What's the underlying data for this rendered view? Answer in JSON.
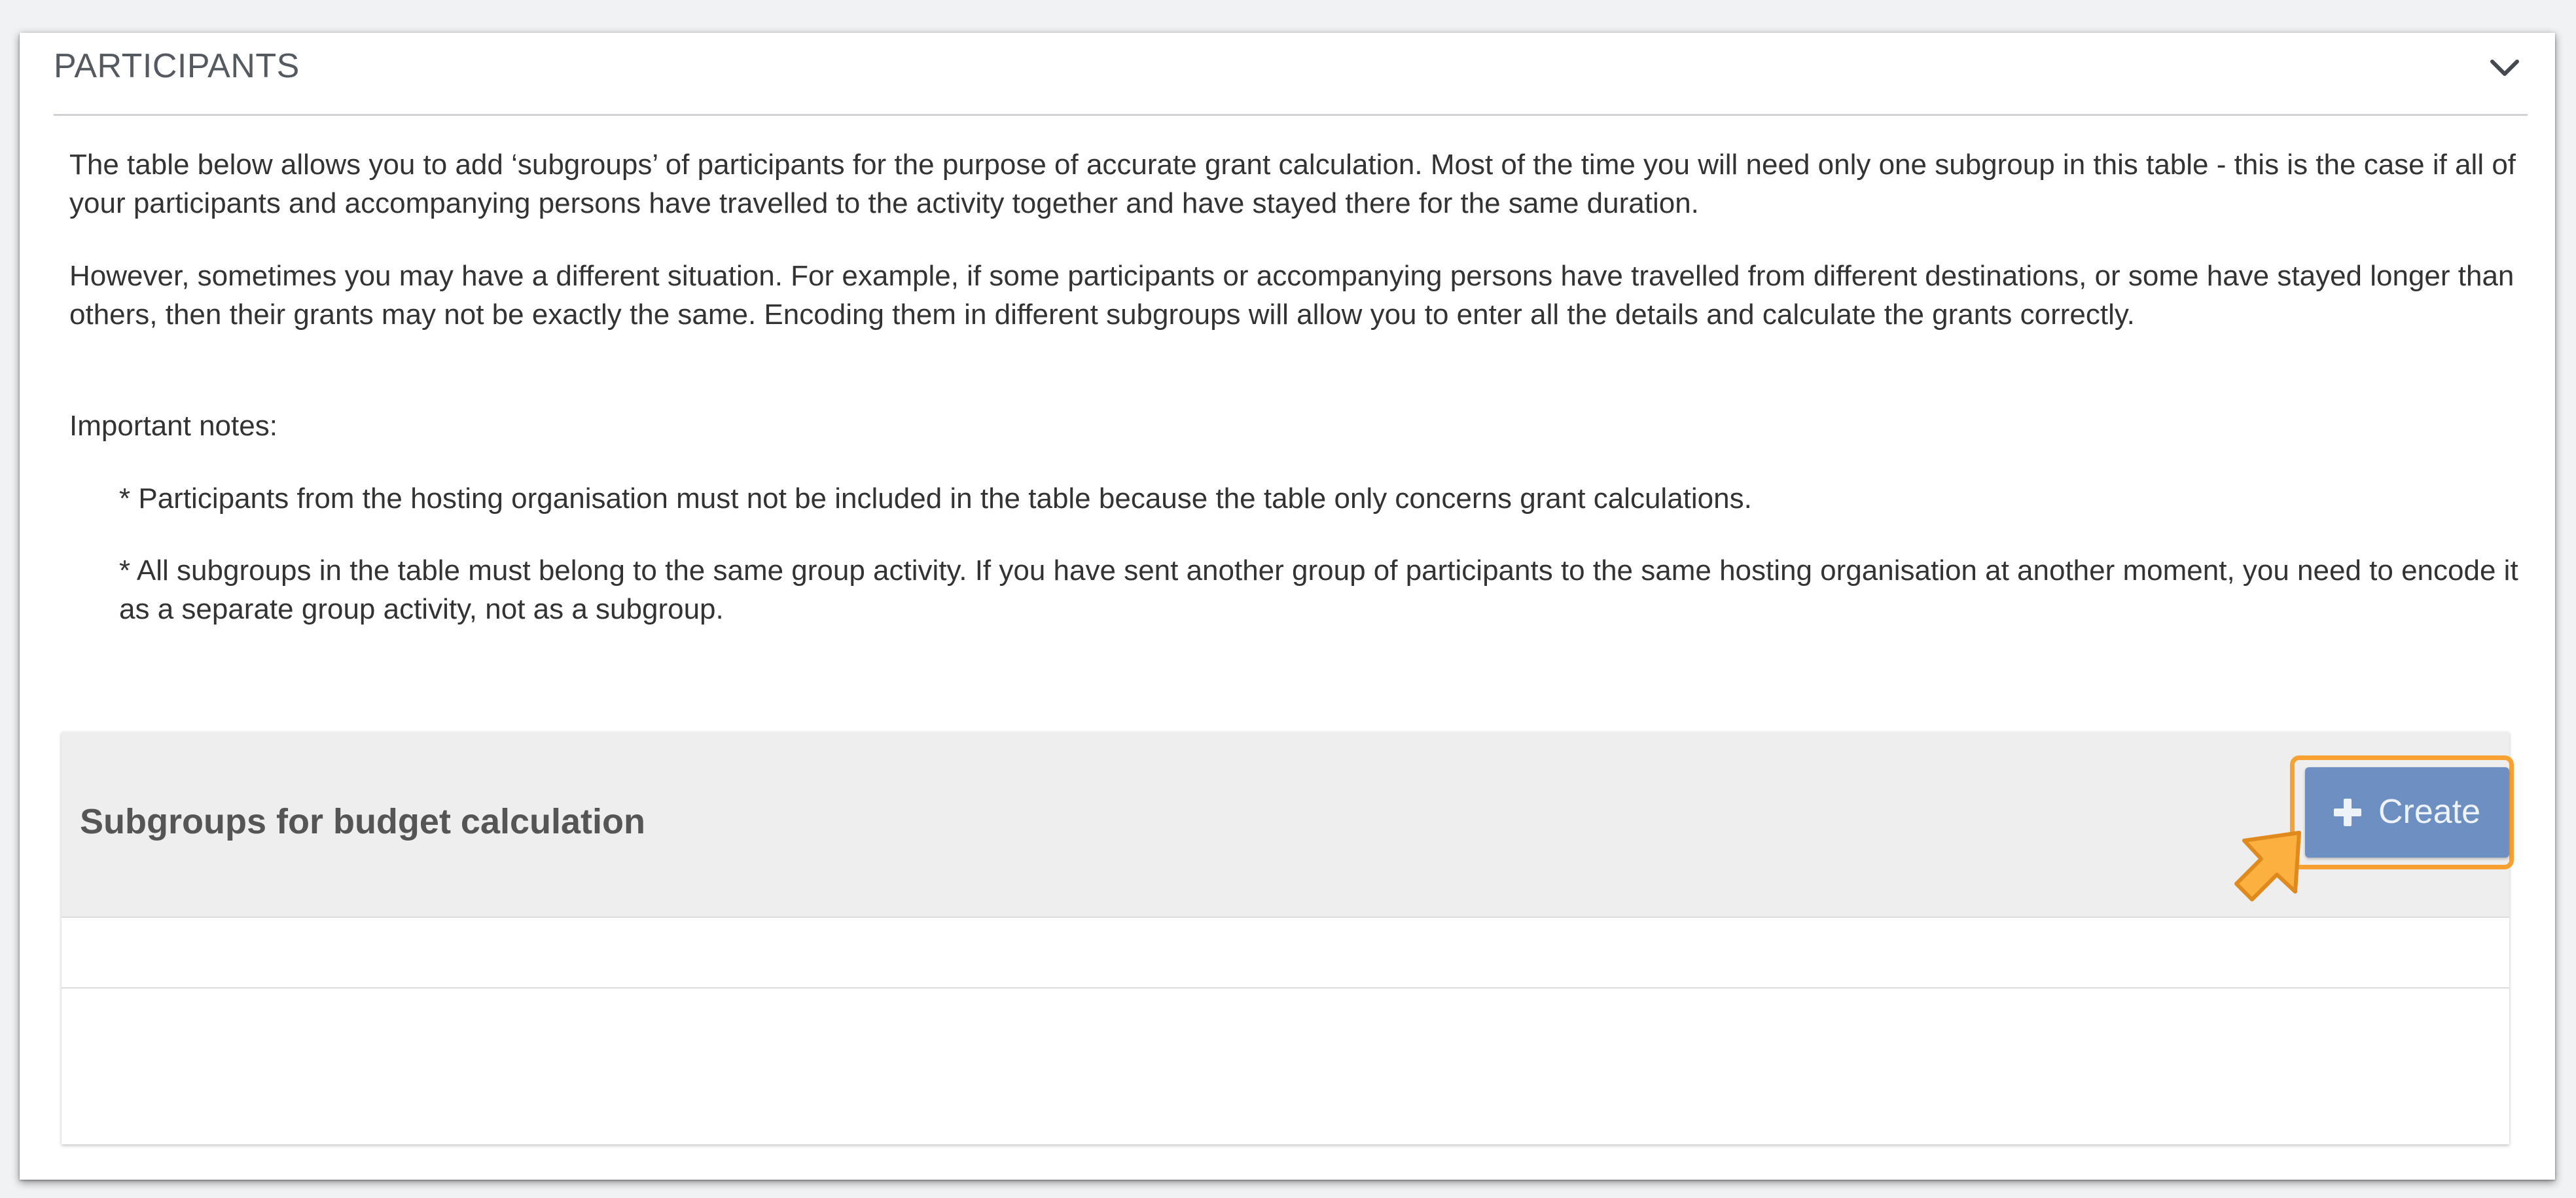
{
  "section": {
    "title": "PARTICIPANTS",
    "collapse_icon": "chevron-down-icon"
  },
  "intro": {
    "paragraph_1": "The table below allows you to add ‘subgroups’ of participants for the purpose of accurate grant calculation. Most of the time you will need only one subgroup in this table - this is the case if all of your participants and accompanying persons have travelled to the activity together and have stayed there for the same duration.",
    "paragraph_2": "However, sometimes you may have a different situation. For example, if some participants or accompanying persons have travelled from different destinations, or some have stayed longer than others, then their grants may not be exactly the same. Encoding them in different subgroups will allow you to enter all the details and calculate the grants correctly.",
    "important_label": "Important notes:",
    "notes": [
      "* Participants from the hosting organisation must not be included in the table because the table only concerns grant calculations.",
      "* All subgroups in the table must belong to the same group activity. If you have sent another group of participants to the same hosting organisation at another moment, you need to encode it as a separate group activity, not as a subgroup."
    ]
  },
  "table": {
    "title": "Subgroups for budget calculation",
    "create_label": "Create",
    "create_icon": "plus-icon"
  },
  "colors": {
    "button_bg": "#6d8fc2",
    "highlight": "#f7a133",
    "cursor_fill": "#fbb040",
    "table_head_bg": "#eeeeee"
  }
}
